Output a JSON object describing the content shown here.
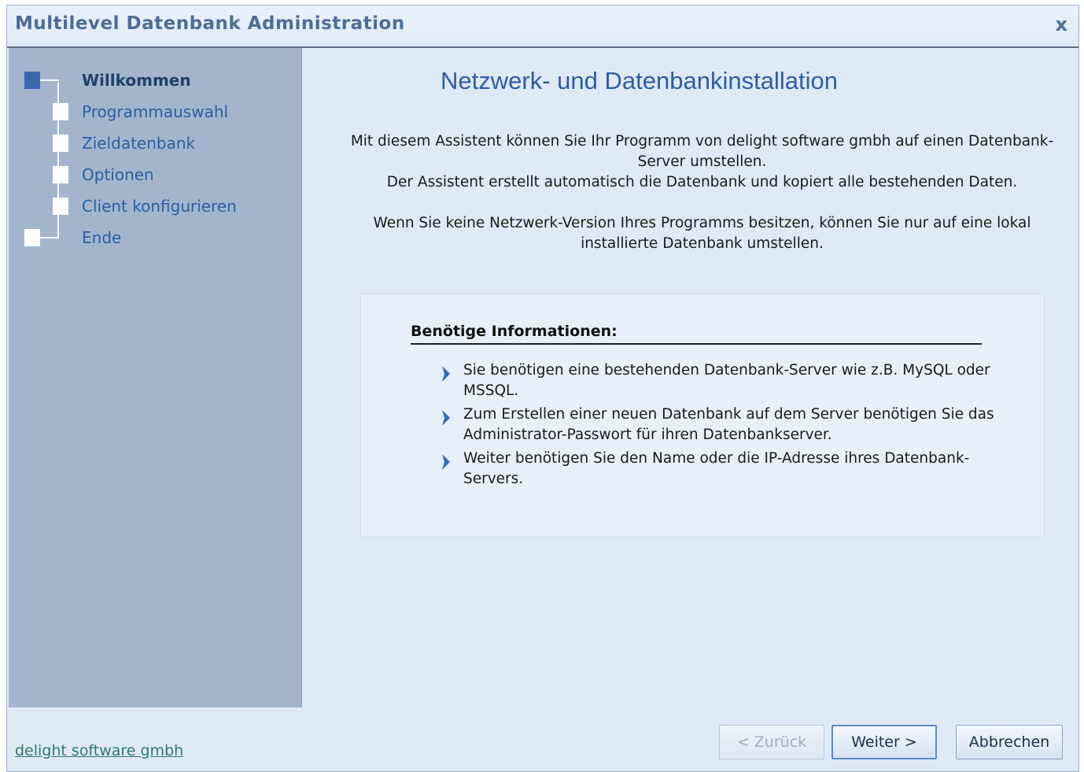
{
  "window": {
    "title": "Multilevel Datenbank Administration",
    "close_label": "x"
  },
  "sidebar": {
    "steps": [
      {
        "label": "Willkommen",
        "active": true
      },
      {
        "label": "Programmauswahl",
        "active": false
      },
      {
        "label": "Zieldatenbank",
        "active": false
      },
      {
        "label": "Optionen",
        "active": false
      },
      {
        "label": "Client konfigurieren",
        "active": false
      },
      {
        "label": "Ende",
        "active": false
      }
    ]
  },
  "main": {
    "heading": "Netzwerk- und Datenbankinstallation",
    "intro_1": "Mit diesem Assistent können Sie Ihr Programm von delight software gmbh auf einen Datenbank-Server umstellen.",
    "intro_2": "Der Assistent erstellt automatisch die Datenbank und kopiert alle bestehenden Daten.",
    "intro_3": "Wenn Sie keine Netzwerk-Version Ihres Programms besitzen, können Sie nur auf eine lokal installierte Datenbank umstellen.",
    "info_title": "Benötige Informationen:",
    "info_items": [
      "Sie benötigen eine bestehenden Datenbank-Server wie z.B. MySQL oder MSSQL.",
      "Zum Erstellen einer neuen Datenbank auf dem Server benötigen Sie das Administrator-Passwort für ihren Datenbankserver.",
      "Weiter benötigen Sie den Name oder die IP-Adresse ihres Datenbank-Servers."
    ]
  },
  "footer": {
    "link": "delight software gmbh",
    "back_label": "< Zurück",
    "next_label": "Weiter >",
    "cancel_label": "Abbrechen"
  },
  "colors": {
    "accent": "#2b5ea3",
    "sidebar_bg": "#a2b5cd",
    "window_bg": "#dfe9f5"
  }
}
